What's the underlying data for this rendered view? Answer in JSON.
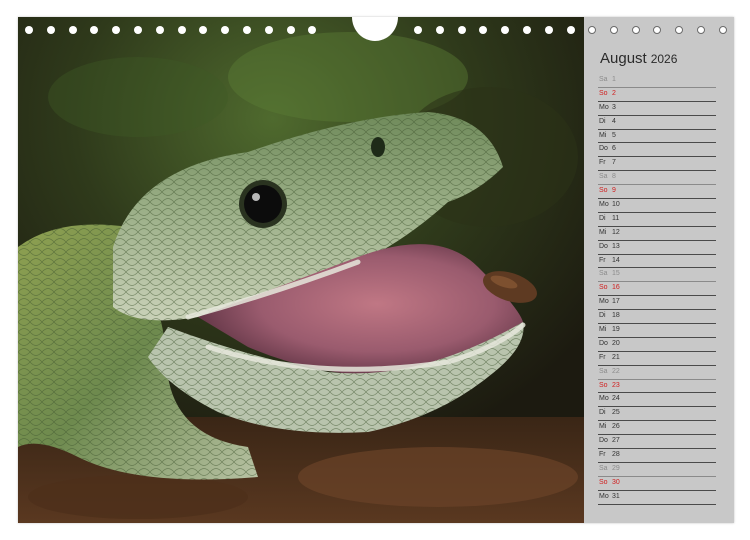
{
  "calendar": {
    "month": "August",
    "year": "2026",
    "days": [
      {
        "dow": "Sa",
        "day": "1",
        "type": "sat"
      },
      {
        "dow": "So",
        "day": "2",
        "type": "sun"
      },
      {
        "dow": "Mo",
        "day": "3",
        "type": "week"
      },
      {
        "dow": "Di",
        "day": "4",
        "type": "week"
      },
      {
        "dow": "Mi",
        "day": "5",
        "type": "week"
      },
      {
        "dow": "Do",
        "day": "6",
        "type": "week"
      },
      {
        "dow": "Fr",
        "day": "7",
        "type": "week"
      },
      {
        "dow": "Sa",
        "day": "8",
        "type": "sat"
      },
      {
        "dow": "So",
        "day": "9",
        "type": "sun"
      },
      {
        "dow": "Mo",
        "day": "10",
        "type": "week"
      },
      {
        "dow": "Di",
        "day": "11",
        "type": "week"
      },
      {
        "dow": "Mi",
        "day": "12",
        "type": "week"
      },
      {
        "dow": "Do",
        "day": "13",
        "type": "week"
      },
      {
        "dow": "Fr",
        "day": "14",
        "type": "week"
      },
      {
        "dow": "Sa",
        "day": "15",
        "type": "sat"
      },
      {
        "dow": "So",
        "day": "16",
        "type": "sun"
      },
      {
        "dow": "Mo",
        "day": "17",
        "type": "week"
      },
      {
        "dow": "Di",
        "day": "18",
        "type": "week"
      },
      {
        "dow": "Mi",
        "day": "19",
        "type": "week"
      },
      {
        "dow": "Do",
        "day": "20",
        "type": "week"
      },
      {
        "dow": "Fr",
        "day": "21",
        "type": "week"
      },
      {
        "dow": "Sa",
        "day": "22",
        "type": "sat"
      },
      {
        "dow": "So",
        "day": "23",
        "type": "sun"
      },
      {
        "dow": "Mo",
        "day": "24",
        "type": "week"
      },
      {
        "dow": "Di",
        "day": "25",
        "type": "week"
      },
      {
        "dow": "Mi",
        "day": "26",
        "type": "week"
      },
      {
        "dow": "Do",
        "day": "27",
        "type": "week"
      },
      {
        "dow": "Fr",
        "day": "28",
        "type": "week"
      },
      {
        "dow": "Sa",
        "day": "29",
        "type": "sat"
      },
      {
        "dow": "So",
        "day": "30",
        "type": "sun"
      },
      {
        "dow": "Mo",
        "day": "31",
        "type": "week"
      }
    ]
  },
  "colors": {
    "sunday": "#d11f1f",
    "saturday": "#8c8c8c",
    "weekday": "#333333",
    "panel": "#c8c8c8"
  },
  "photo": {
    "subject": "snake-head-open-mouth"
  }
}
